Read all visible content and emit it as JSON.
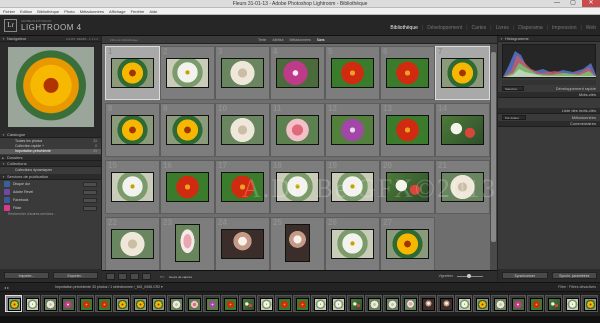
{
  "window": {
    "title": "Fleurs 31-01-13 - Adobe Photoshop Lightroom - Bibliothèque",
    "buttons": [
      "—",
      "▢",
      "✕"
    ]
  },
  "menu": [
    "Fichier",
    "Edition",
    "Bibliothèque",
    "Photo",
    "Métadonnées",
    "Affichage",
    "Fenêtre",
    "Aide"
  ],
  "identity": {
    "logo": "Lr",
    "app_small": "ADOBE PHOTOSHOP",
    "app_big": "LIGHTROOM 4",
    "modules": [
      "Bibliothèque",
      "Développement",
      "Cartes",
      "Livres",
      "Diaporama",
      "Impression",
      "Web"
    ],
    "active_module": "Bibliothèque"
  },
  "left_panel": {
    "navigator": {
      "title": "Navigateur",
      "zoom_options": "AJUST.  REMPL.  1:1  1:4"
    },
    "catalog": {
      "title": "Catalogue",
      "items": [
        {
          "label": "Toutes les photos",
          "count": "33"
        },
        {
          "label": "Collection rapide +",
          "count": "0"
        },
        {
          "label": "Importation précédente",
          "count": "33"
        }
      ]
    },
    "folders": {
      "title": "Dossiers"
    },
    "collections": {
      "title": "Collections",
      "item": "Collections dynamiques"
    },
    "publish": {
      "title": "Services de publication",
      "services": [
        {
          "label": "Disque dur",
          "color": "#3a5f9a"
        },
        {
          "label": "Adobe Revel",
          "color": "#6b4aa0"
        },
        {
          "label": "Facebook",
          "color": "#3b5998"
        },
        {
          "label": "Flickr",
          "color": "#d83a8c"
        }
      ],
      "more": "Rechercher d'autres services..."
    },
    "buttons": {
      "import": "Importer...",
      "export": "Exporter..."
    }
  },
  "center": {
    "filter_label": "Filtre de bibliothèque :",
    "filter_tabs": [
      "Texte",
      "Attribut",
      "Métadonnées",
      "Sans"
    ],
    "active_filter": "Sans",
    "cells": [
      {
        "num": "1",
        "flower": "f-yellow",
        "selected": true,
        "shape": "land"
      },
      {
        "num": "2",
        "flower": "f-white",
        "selected": false,
        "shape": "land"
      },
      {
        "num": "3",
        "flower": "f-rose",
        "selected": false,
        "shape": "land"
      },
      {
        "num": "4",
        "flower": "f-pink",
        "selected": false,
        "shape": "land"
      },
      {
        "num": "5",
        "flower": "f-red",
        "selected": false,
        "shape": "land"
      },
      {
        "num": "6",
        "flower": "f-red",
        "selected": false,
        "shape": "land"
      },
      {
        "num": "7",
        "flower": "f-yellow",
        "selected": true,
        "shape": "land"
      },
      {
        "num": "8",
        "flower": "f-yellow",
        "selected": false,
        "shape": "land"
      },
      {
        "num": "9",
        "flower": "f-yellow",
        "selected": false,
        "shape": "land"
      },
      {
        "num": "10",
        "flower": "f-rose",
        "selected": false,
        "shape": "land"
      },
      {
        "num": "11",
        "flower": "f-pinkrose",
        "selected": false,
        "shape": "land"
      },
      {
        "num": "12",
        "flower": "f-purple",
        "selected": false,
        "shape": "land"
      },
      {
        "num": "13",
        "flower": "f-red",
        "selected": false,
        "shape": "land"
      },
      {
        "num": "14",
        "flower": "f-mixed",
        "selected": false,
        "shape": "land"
      },
      {
        "num": "15",
        "flower": "f-white",
        "selected": false,
        "shape": "land"
      },
      {
        "num": "16",
        "flower": "f-red",
        "selected": false,
        "shape": "land"
      },
      {
        "num": "17",
        "flower": "f-red",
        "selected": false,
        "shape": "land"
      },
      {
        "num": "18",
        "flower": "f-white",
        "selected": false,
        "shape": "land"
      },
      {
        "num": "19",
        "flower": "f-white",
        "selected": false,
        "shape": "land"
      },
      {
        "num": "20",
        "flower": "f-mixed",
        "selected": false,
        "shape": "land"
      },
      {
        "num": "21",
        "flower": "f-rose",
        "selected": false,
        "shape": "land"
      },
      {
        "num": "22",
        "flower": "f-rose",
        "selected": false,
        "shape": "land"
      },
      {
        "num": "23",
        "flower": "f-tulip",
        "selected": false,
        "shape": "port"
      },
      {
        "num": "24",
        "flower": "f-dark",
        "selected": false,
        "shape": "land"
      },
      {
        "num": "25",
        "flower": "f-dark",
        "selected": false,
        "shape": "port"
      },
      {
        "num": "26",
        "flower": "f-white",
        "selected": false,
        "shape": "land"
      },
      {
        "num": "27",
        "flower": "f-yellow",
        "selected": false,
        "shape": "land"
      }
    ],
    "toolbar": {
      "sort_label": "Tri :",
      "sort_value": "Heure de capture",
      "thumb_label": "Vignettes"
    }
  },
  "right_panel": {
    "histogram_title": "Histogramme",
    "quick_develop": "Développement rapide",
    "keywords_title": "Mots-clés",
    "keyword_list": "Liste des mots-clés",
    "metadata": "Métadonnées",
    "comments": "Commentaires",
    "preset_label": "Par défaut",
    "saved_preset": "Sélection per...",
    "buttons": {
      "sync": "Synchroniser",
      "sync_settings": "Synchr. paramètres"
    }
  },
  "filmstrip": {
    "nav": "◂ ▸",
    "info": "Importation précédente   33 photos / 1 sélectionnée /_MG_0065.CR2 ▾",
    "filter_label": "Filtre :",
    "filter_value": "Filtres désactivés",
    "thumbs": [
      "f-yellow",
      "f-white",
      "f-rose",
      "f-pink",
      "f-red",
      "f-red",
      "f-yellow",
      "f-yellow",
      "f-yellow",
      "f-rose",
      "f-pinkrose",
      "f-purple",
      "f-red",
      "f-mixed",
      "f-white",
      "f-red",
      "f-red",
      "f-white",
      "f-white",
      "f-mixed",
      "f-rose",
      "f-rose",
      "f-tulip",
      "f-dark",
      "f-dark",
      "f-white",
      "f-yellow",
      "f-rose",
      "f-pink",
      "f-red",
      "f-mixed",
      "f-white",
      "f-yellow"
    ]
  },
  "watermark": "A.Do Be GFX©2013"
}
